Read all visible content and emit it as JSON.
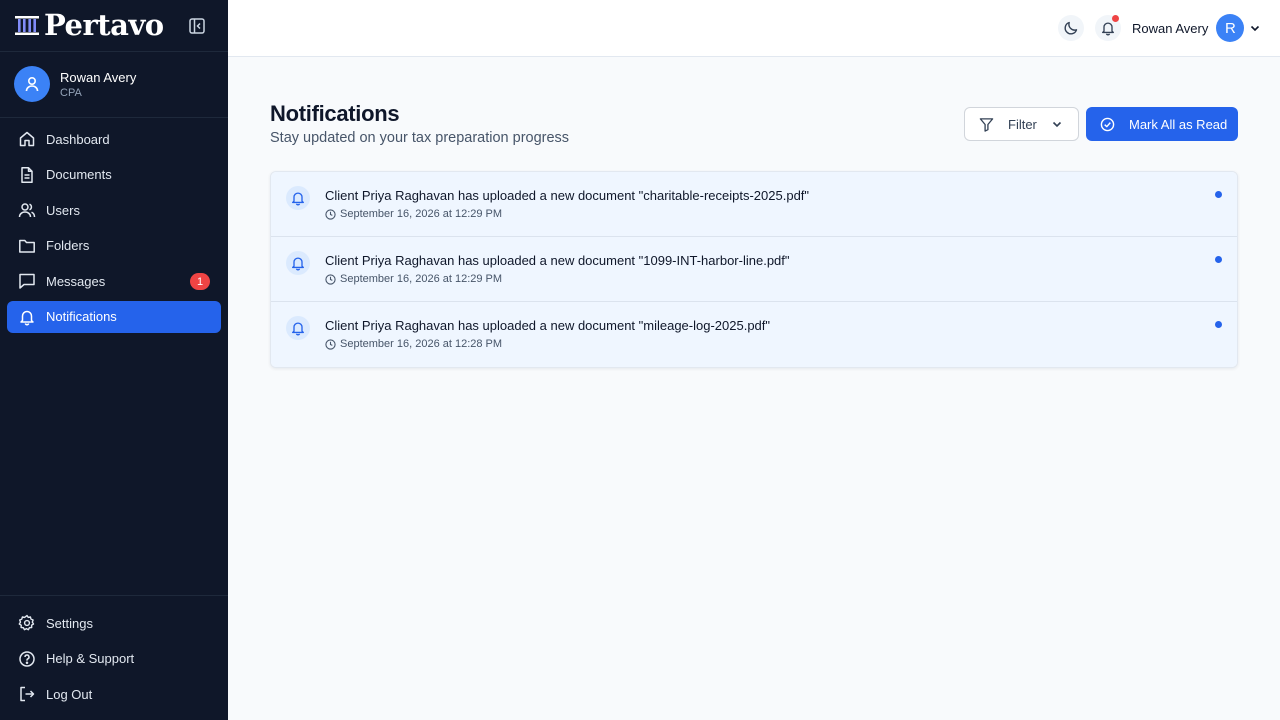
{
  "brand": {
    "name": "Pertavo"
  },
  "profile": {
    "name": "Rowan Avery",
    "role": "CPA"
  },
  "sidebar": {
    "items": [
      {
        "label": "Dashboard",
        "icon": "home-icon"
      },
      {
        "label": "Documents",
        "icon": "document-icon"
      },
      {
        "label": "Users",
        "icon": "users-icon"
      },
      {
        "label": "Folders",
        "icon": "folder-icon"
      },
      {
        "label": "Messages",
        "icon": "message-icon",
        "badge": "1"
      },
      {
        "label": "Notifications",
        "icon": "bell-icon",
        "active": true
      }
    ],
    "bottom_items": [
      {
        "label": "Settings",
        "icon": "gear-icon"
      },
      {
        "label": "Help & Support",
        "icon": "help-icon"
      },
      {
        "label": "Log Out",
        "icon": "logout-icon"
      }
    ]
  },
  "header": {
    "user_name": "Rowan Avery",
    "user_initial": "R"
  },
  "page": {
    "title": "Notifications",
    "subtitle": "Stay updated on your tax preparation progress",
    "filter_label": "Filter",
    "mark_all_label": "Mark All as Read"
  },
  "notifications": [
    {
      "message": "Client Priya Raghavan has uploaded a new document \"charitable-receipts-2025.pdf\"",
      "time": "September 16, 2026 at 12:29 PM",
      "unread": true
    },
    {
      "message": "Client Priya Raghavan has uploaded a new document \"1099-INT-harbor-line.pdf\"",
      "time": "September 16, 2026 at 12:29 PM",
      "unread": true
    },
    {
      "message": "Client Priya Raghavan has uploaded a new document \"mileage-log-2025.pdf\"",
      "time": "September 16, 2026 at 12:28 PM",
      "unread": true
    }
  ],
  "colors": {
    "sidebar_bg": "#0f1729",
    "accent": "#2563eb",
    "badge": "#ef4444",
    "unread_bg": "#eff6ff"
  }
}
